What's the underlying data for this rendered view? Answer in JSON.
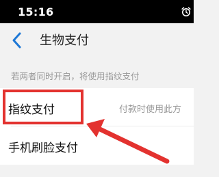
{
  "status_bar": {
    "time": "15:16",
    "icons": [
      "alarm-icon"
    ]
  },
  "header": {
    "back_icon": "chevron-left-icon",
    "title": "生物支付"
  },
  "hint": "若两者同时开启，将使用指纹支付",
  "options": [
    {
      "label": "指纹支付",
      "description": "付款时使用此方"
    },
    {
      "label": "手机刷脸支付",
      "description": ""
    }
  ],
  "annotation": {
    "color": "#e3322f",
    "target": "指纹支付"
  },
  "colors": {
    "accent": "#1e78d6",
    "background": "#f2f2f2",
    "annotation": "#e3322f"
  }
}
